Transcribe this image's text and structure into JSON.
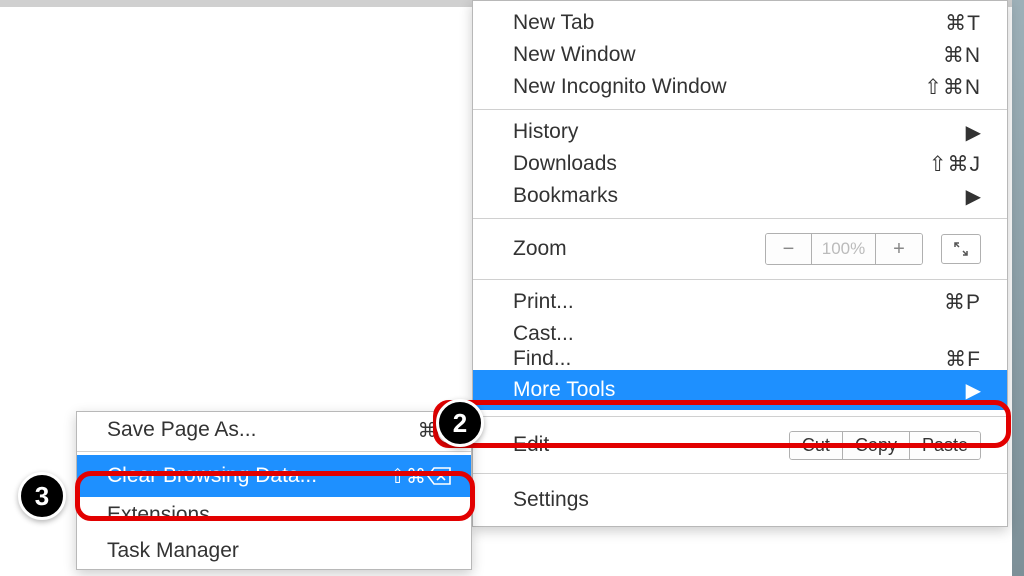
{
  "mainMenu": {
    "group1": [
      {
        "label": "New Tab",
        "shortcut": "⌘T"
      },
      {
        "label": "New Window",
        "shortcut": "⌘N"
      },
      {
        "label": "New Incognito Window",
        "shortcut": "⇧⌘N"
      }
    ],
    "group2": [
      {
        "label": "History",
        "arrow": true
      },
      {
        "label": "Downloads",
        "shortcut": "⇧⌘J"
      },
      {
        "label": "Bookmarks",
        "arrow": true
      }
    ],
    "zoom": {
      "label": "Zoom",
      "value": "100%"
    },
    "group3": [
      {
        "label": "Print...",
        "shortcut": "⌘P"
      },
      {
        "label": "Cast..."
      },
      {
        "label": "Find...",
        "shortcut": "⌘F"
      },
      {
        "label": "More Tools",
        "arrow": true,
        "highlight": true
      }
    ],
    "edit": {
      "label": "Edit",
      "cut": "Cut",
      "copy": "Copy",
      "paste": "Paste"
    },
    "settings": {
      "label": "Settings"
    }
  },
  "submenu": {
    "save": {
      "label": "Save Page As...",
      "shortcut": "⌘S"
    },
    "clear": {
      "label": "Clear Browsing Data...",
      "shortcut": "⇧⌘"
    },
    "ext": {
      "label": "Extensions"
    },
    "task": {
      "label": "Task Manager"
    }
  },
  "badges": {
    "two": "2",
    "three": "3"
  }
}
